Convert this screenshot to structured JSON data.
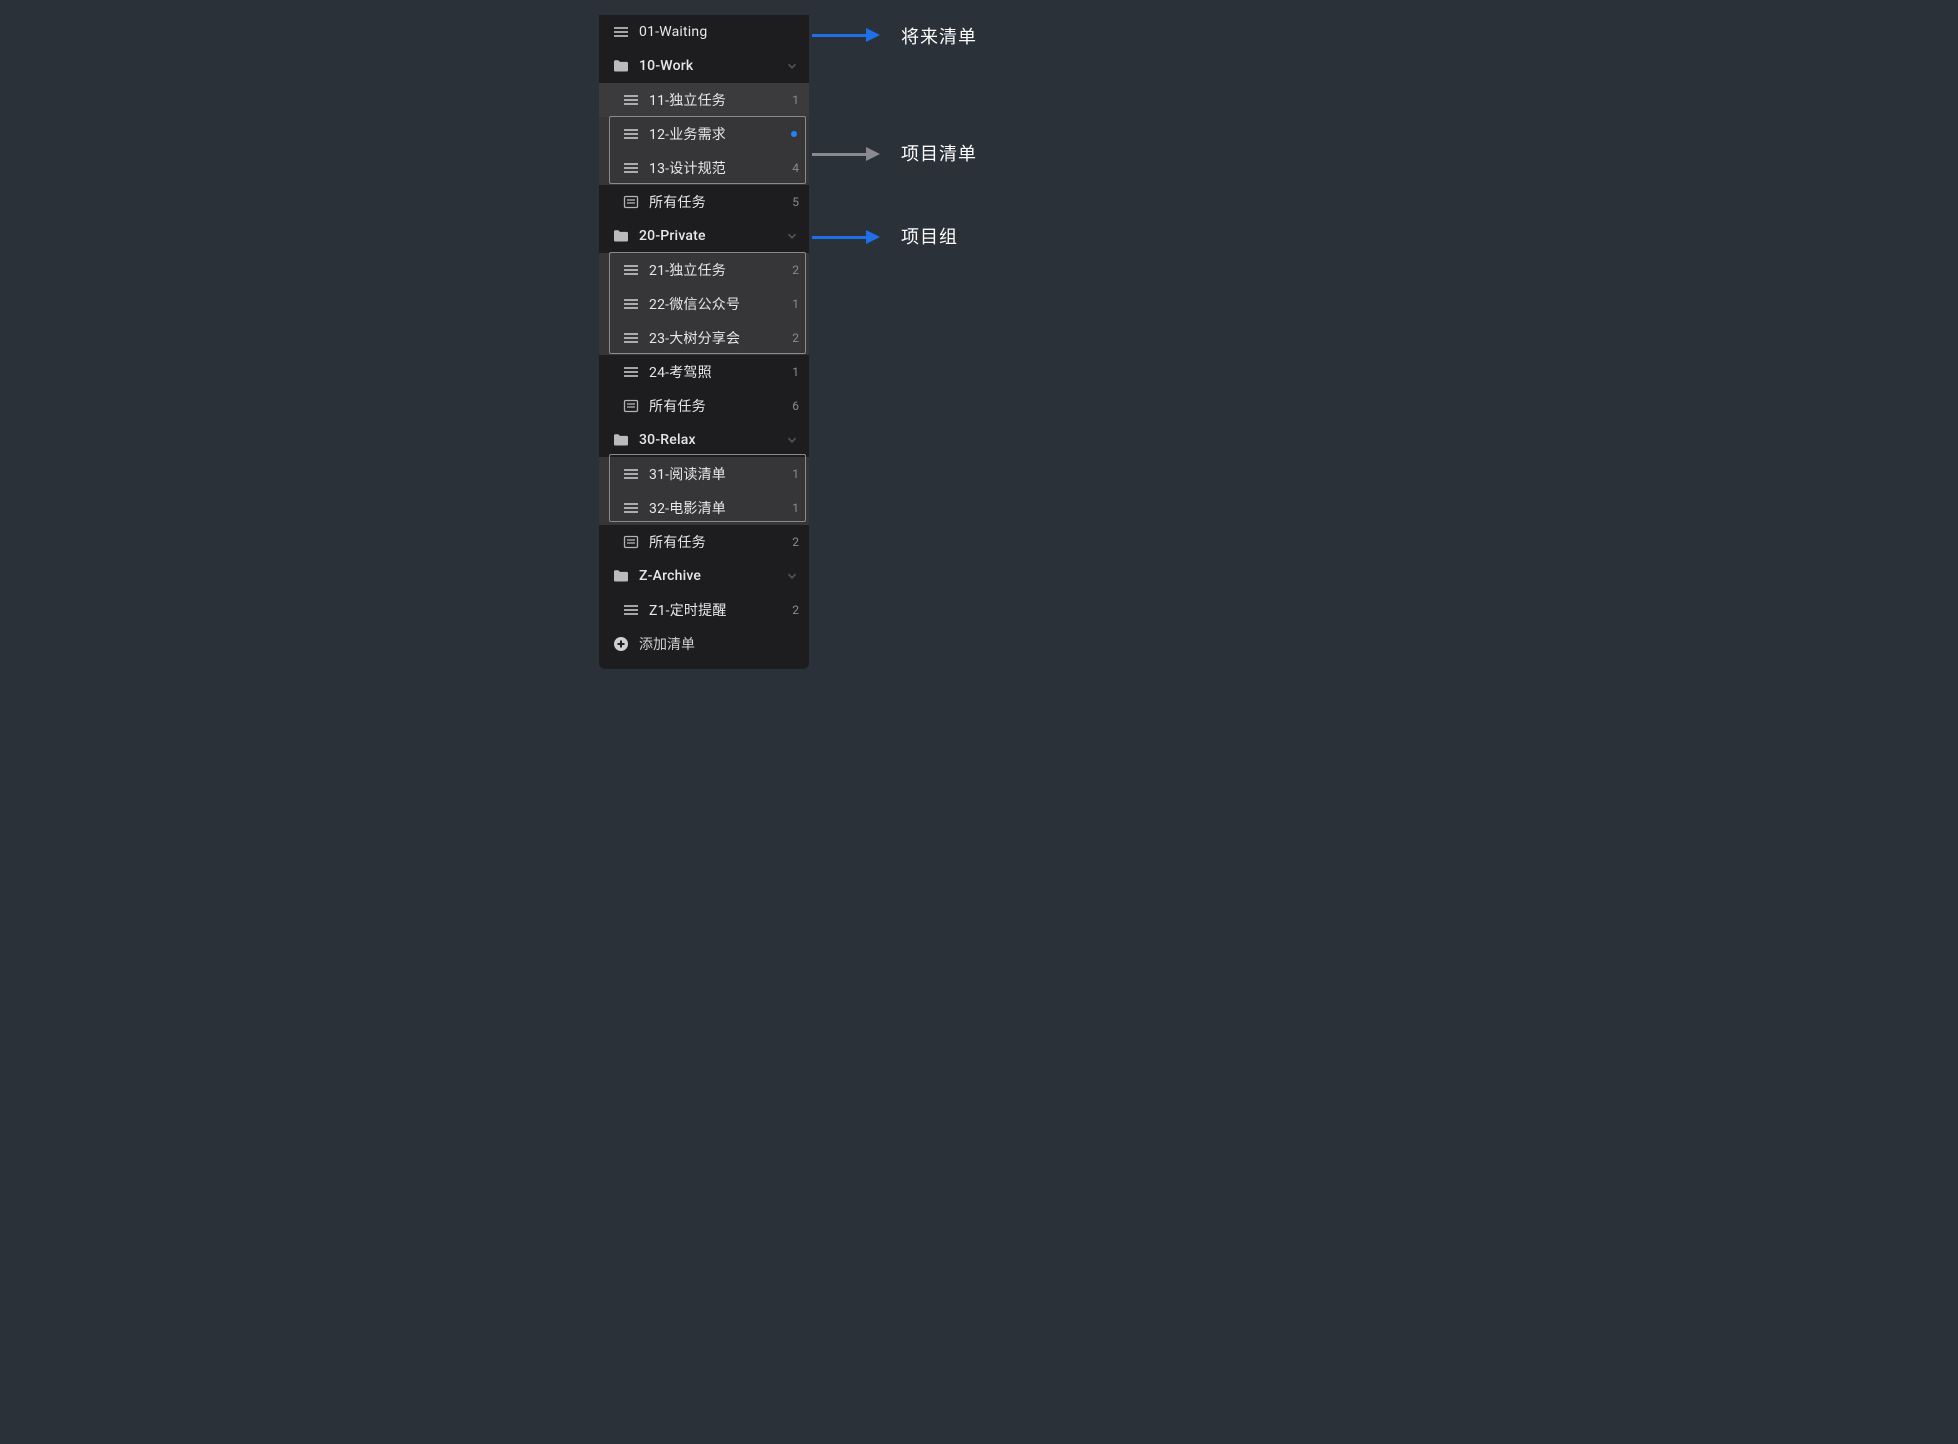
{
  "annotations": {
    "a1_label": "将来清单",
    "a2_label": "项目清单",
    "a3_label": "项目组"
  },
  "sidebar": {
    "addList": "添加清单",
    "items": [
      {
        "kind": "list",
        "icon": "list",
        "label": "01-Waiting",
        "selected": false
      },
      {
        "kind": "folder",
        "icon": "folder",
        "label": "10-Work",
        "expanded": true
      },
      {
        "kind": "list",
        "icon": "list",
        "label": "11-独立任务",
        "count": "1",
        "child": true,
        "selected": true
      },
      {
        "kind": "list",
        "icon": "list",
        "label": "12-业务需求",
        "dot": true,
        "child": true,
        "boxed": "b1"
      },
      {
        "kind": "list",
        "icon": "list",
        "label": "13-设计规范",
        "count": "4",
        "child": true,
        "boxed": "b1"
      },
      {
        "kind": "smart",
        "icon": "smart",
        "label": "所有任务",
        "count": "5",
        "child": true
      },
      {
        "kind": "folder",
        "icon": "folder",
        "label": "20-Private",
        "expanded": true
      },
      {
        "kind": "list",
        "icon": "list",
        "label": "21-独立任务",
        "count": "2",
        "child": true,
        "boxed": "b2"
      },
      {
        "kind": "list",
        "icon": "list",
        "label": "22-微信公众号",
        "count": "1",
        "child": true,
        "boxed": "b2"
      },
      {
        "kind": "list",
        "icon": "list",
        "label": "23-大树分享会",
        "count": "2",
        "child": true,
        "boxed": "b2"
      },
      {
        "kind": "list",
        "icon": "list",
        "label": "24-考驾照",
        "count": "1",
        "child": true
      },
      {
        "kind": "smart",
        "icon": "smart",
        "label": "所有任务",
        "count": "6",
        "child": true
      },
      {
        "kind": "folder",
        "icon": "folder",
        "label": "30-Relax",
        "expanded": true
      },
      {
        "kind": "list",
        "icon": "list",
        "label": "31-阅读清单",
        "count": "1",
        "child": true,
        "boxed": "b3"
      },
      {
        "kind": "list",
        "icon": "list",
        "label": "32-电影清单",
        "count": "1",
        "child": true,
        "boxed": "b3"
      },
      {
        "kind": "smart",
        "icon": "smart",
        "label": "所有任务",
        "count": "2",
        "child": true
      },
      {
        "kind": "folder",
        "icon": "folder",
        "label": "Z-Archive",
        "expanded": true
      },
      {
        "kind": "list",
        "icon": "list",
        "label": "Z1-定时提醒",
        "count": "2",
        "child": true
      }
    ]
  }
}
